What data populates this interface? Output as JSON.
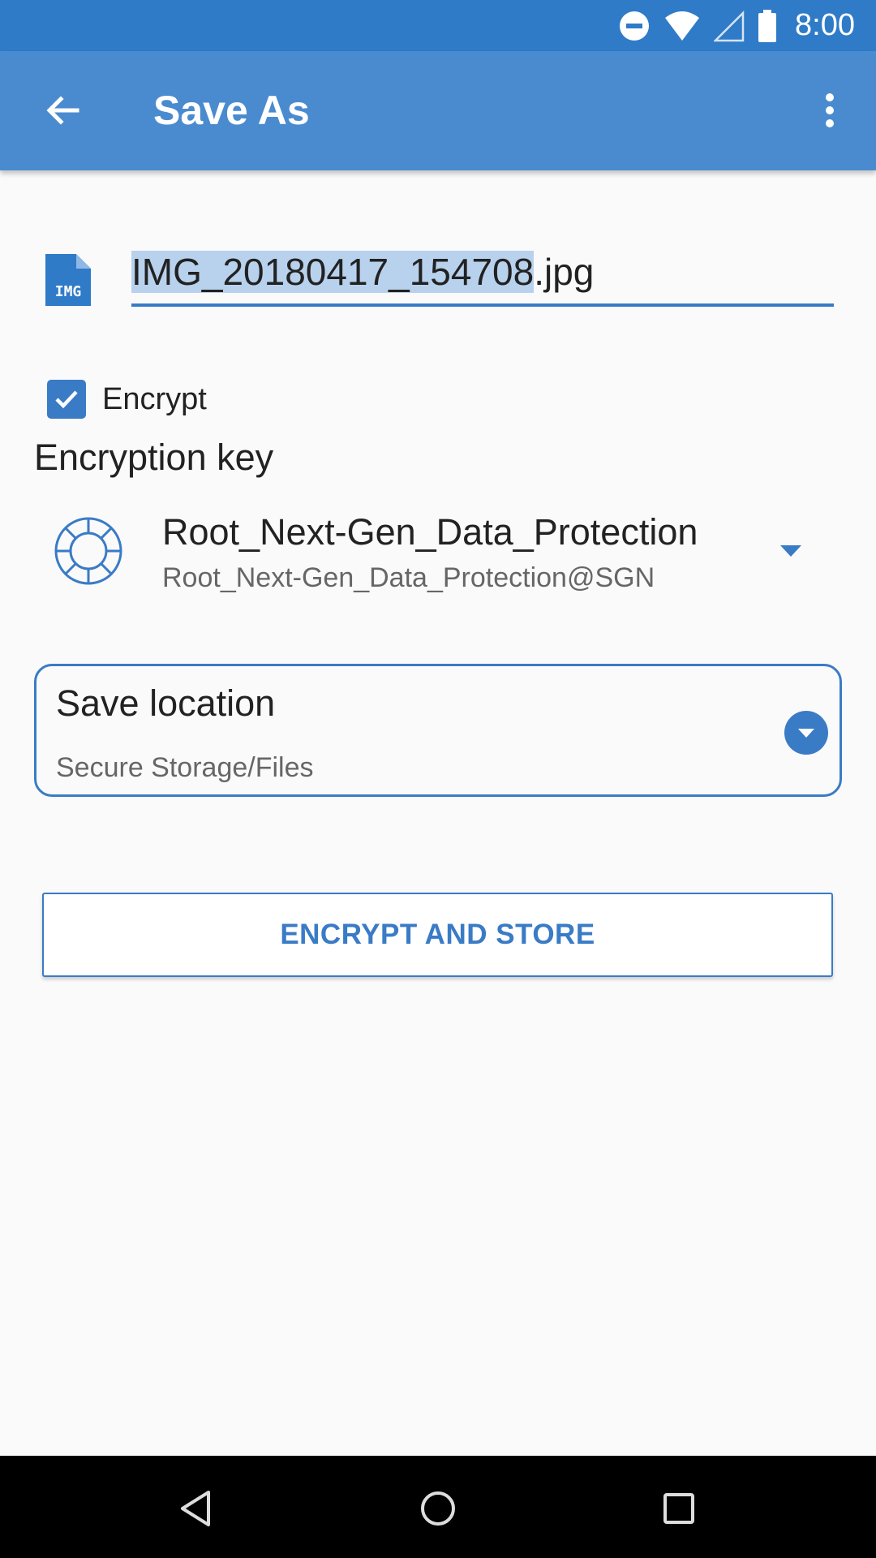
{
  "status_bar": {
    "time": "8:00",
    "icons": [
      "do-not-disturb-icon",
      "wifi-icon",
      "signal-icon",
      "battery-icon"
    ]
  },
  "app_bar": {
    "title": "Save As",
    "back_icon": "arrow-back-icon",
    "overflow_icon": "more-vert-icon"
  },
  "file": {
    "icon_label": "IMG",
    "name_selected": "IMG_20180417_154708",
    "name_extension": ".jpg"
  },
  "encrypt": {
    "label": "Encrypt",
    "checked": true
  },
  "encryption_key": {
    "section_label": "Encryption key",
    "key_name": "Root_Next-Gen_Data_Protection",
    "key_id": "Root_Next-Gen_Data_Protection@SGN"
  },
  "save_location": {
    "title": "Save location",
    "value": "Secure Storage/Files"
  },
  "action": {
    "label": "ENCRYPT AND STORE"
  },
  "colors": {
    "status_bar": "#2f7bc8",
    "app_bar": "#4a8bd0",
    "accent": "#3a7bc6",
    "selection": "#b8d2ee"
  }
}
